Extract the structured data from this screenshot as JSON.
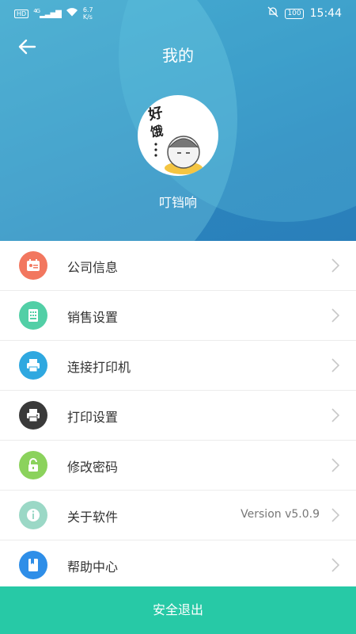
{
  "status_bar": {
    "hd": "HD",
    "network": "4G",
    "speed_value": "6.7",
    "speed_unit": "K/s",
    "battery": "100",
    "time": "15:44"
  },
  "header": {
    "title": "我的",
    "back_icon": "arrow-left-icon",
    "username": "叮铛响",
    "avatar_text": "好饿..."
  },
  "menu": [
    {
      "label": "公司信息",
      "icon": "id-card-icon",
      "color": "#f2775f",
      "value": ""
    },
    {
      "label": "销售设置",
      "icon": "sales-settings-icon",
      "color": "#52cfa6",
      "value": ""
    },
    {
      "label": "连接打印机",
      "icon": "printer-icon",
      "color": "#2fa8e0",
      "value": ""
    },
    {
      "label": "打印设置",
      "icon": "print-settings-icon",
      "color": "#3a3a3a",
      "value": ""
    },
    {
      "label": "修改密码",
      "icon": "unlock-icon",
      "color": "#8bd25c",
      "value": ""
    },
    {
      "label": "关于软件",
      "icon": "info-icon",
      "color": "#9bd8c6",
      "value": "Version v5.0.9"
    },
    {
      "label": "帮助中心",
      "icon": "help-book-icon",
      "color": "#2e8ee8",
      "value": ""
    }
  ],
  "logout_label": "安全退出",
  "colors": {
    "header": "#2f8fc2",
    "accent": "#27c9a6"
  }
}
